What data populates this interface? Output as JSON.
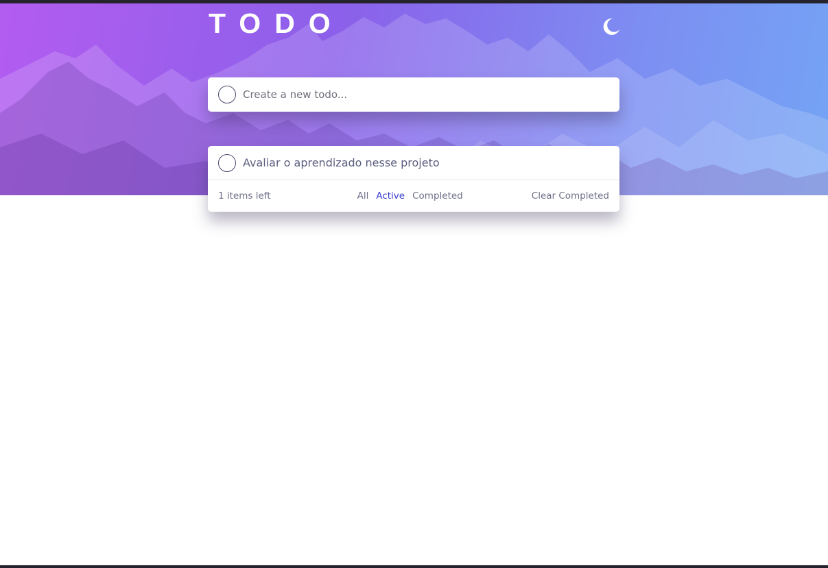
{
  "app": {
    "title": "TODO"
  },
  "theme_toggle": {
    "icon": "moon-icon"
  },
  "new_todo": {
    "placeholder": "Create a new todo..."
  },
  "todos": [
    {
      "text": "Avaliar o aprendizado nesse projeto",
      "completed": false
    }
  ],
  "footer": {
    "items_left": "1 items left",
    "filters": [
      {
        "label": "All",
        "active": false
      },
      {
        "label": "Active",
        "active": true
      },
      {
        "label": "Completed",
        "active": false
      }
    ],
    "clear_label": "Clear Completed"
  },
  "colors": {
    "active_filter": "#3a3fd0",
    "gradient_start": "#b35cf0",
    "gradient_end": "#74a4f4"
  }
}
